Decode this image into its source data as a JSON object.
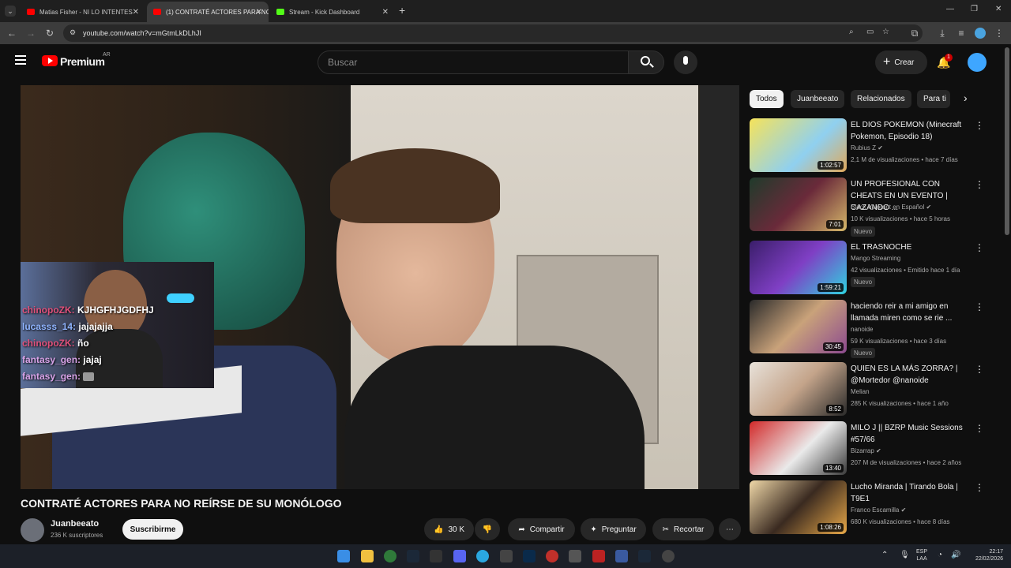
{
  "browser": {
    "tabs": [
      {
        "title": "Matias Fisher - NI LO INTENTES",
        "favicon": "youtube-icon"
      },
      {
        "title": "(1) CONTRATÉ ACTORES PARA NO",
        "favicon": "youtube-icon"
      },
      {
        "title": "Stream - Kick Dashboard",
        "favicon": "kick-icon"
      }
    ],
    "url": "youtube.com/watch?v=mGtmLkDLhJI"
  },
  "youtube": {
    "logo_text": "Premium",
    "region": "AR",
    "search_placeholder": "Buscar",
    "create_label": "Crear",
    "notification_count": "1"
  },
  "stream_overlay": {
    "chat": [
      {
        "user": "chinopoZK:",
        "message": "KJHGFHJGDFHJ",
        "color": "#e0507a"
      },
      {
        "user": "lucasss_14:",
        "message": "jajajajja",
        "color": "#8fb4ff"
      },
      {
        "user": "chinopoZK:",
        "message": "ño",
        "color": "#e0507a"
      },
      {
        "user": "fantasy_gen:",
        "message": "jajaj",
        "color": "#d9a3e8"
      },
      {
        "user": "fantasy_gen:",
        "message": "",
        "color": "#d9a3e8"
      }
    ]
  },
  "video": {
    "title": "CONTRATÉ ACTORES PARA NO REÍRSE DE SU MONÓLOGO",
    "channel": "Juanbeeato",
    "subscribers": "236 K suscriptores",
    "subscribe_label": "Suscribirme",
    "likes": "30 K",
    "share_label": "Compartir",
    "ask_label": "Preguntar",
    "clip_label": "Recortar"
  },
  "chips": [
    "Todos",
    "Juanbeeato",
    "Relacionados",
    "Para ti"
  ],
  "recommendations": [
    {
      "title": "EL DIOS POKEMON (Minecraft Pokemon, Episodio 18)",
      "channel": "Rubius Z",
      "verified": true,
      "meta": "2,1 M de visualizaciones • hace 7 días",
      "duration": "1:02:57",
      "badge": ""
    },
    {
      "title": "UN PROFESIONAL CON CHEATS EN UN EVENTO | CAZANDO ...",
      "channel": "Black Valorant en Español",
      "verified": true,
      "meta": "10 K visualizaciones • hace 5 horas",
      "duration": "7:01",
      "badge": "Nuevo"
    },
    {
      "title": "EL TRASNOCHE",
      "channel": "Mango Streaming",
      "verified": false,
      "meta": "42 visualizaciones • Emitido hace 1 día",
      "duration": "1:59:21",
      "badge": "Nuevo"
    },
    {
      "title": "haciendo reir a mi amigo en llamada miren como se rie ...",
      "channel": "nanoide",
      "verified": false,
      "meta": "59 K visualizaciones • hace 3 días",
      "duration": "30:45",
      "badge": "Nuevo"
    },
    {
      "title": "QUIEN ES LA MÁS ZORRA? | @Mortedor @nanoide",
      "channel": "Melian",
      "verified": false,
      "meta": "285 K visualizaciones • hace 1 año",
      "duration": "8:52",
      "badge": ""
    },
    {
      "title": "MILO J || BZRP Music Sessions #57/66",
      "channel": "Bizarrap",
      "verified": true,
      "meta": "207 M de visualizaciones • hace 2 años",
      "duration": "13:40",
      "badge": ""
    },
    {
      "title": "Lucho Miranda | Tirando Bola | T9E1",
      "channel": "Franco Escamilla",
      "verified": true,
      "meta": "680 K visualizaciones • hace 8 días",
      "duration": "1:08:26",
      "badge": ""
    }
  ],
  "taskbar": {
    "lang": "ESP",
    "layout": "LAA",
    "time": "22:17",
    "date": "22/02/2026"
  }
}
